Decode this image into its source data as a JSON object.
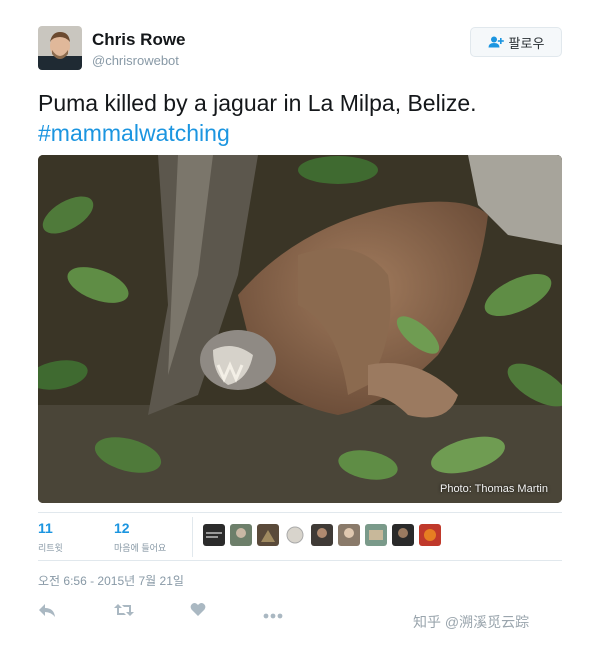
{
  "tweet": {
    "user": {
      "name": "Chris Rowe",
      "handle": "@chrisrowebot"
    },
    "follow_label": "팔로우",
    "text": "Puma killed by a jaguar in La Milpa, Belize.",
    "hashtag": "#mammalwatching",
    "photo_credit": "Photo: Thomas Martin",
    "stats": {
      "retweets": {
        "count": "11",
        "label": "리트윗"
      },
      "likes": {
        "count": "12",
        "label": "마음에 들어요"
      }
    },
    "timestamp": "오전 6:56 - 2015년 7월 21일",
    "actions": [
      "reply-icon",
      "retweet-icon",
      "like-icon",
      "more-icon"
    ],
    "likers": [
      "liker-1",
      "liker-2",
      "liker-3",
      "liker-4",
      "liker-5",
      "liker-6",
      "liker-7",
      "liker-8",
      "liker-9"
    ]
  },
  "watermark": "知乎 @溯溪觅云踪",
  "colors": {
    "accent": "#1b95e0",
    "muted": "#8899a6",
    "divider": "#e1e8ed",
    "text": "#14171a"
  }
}
